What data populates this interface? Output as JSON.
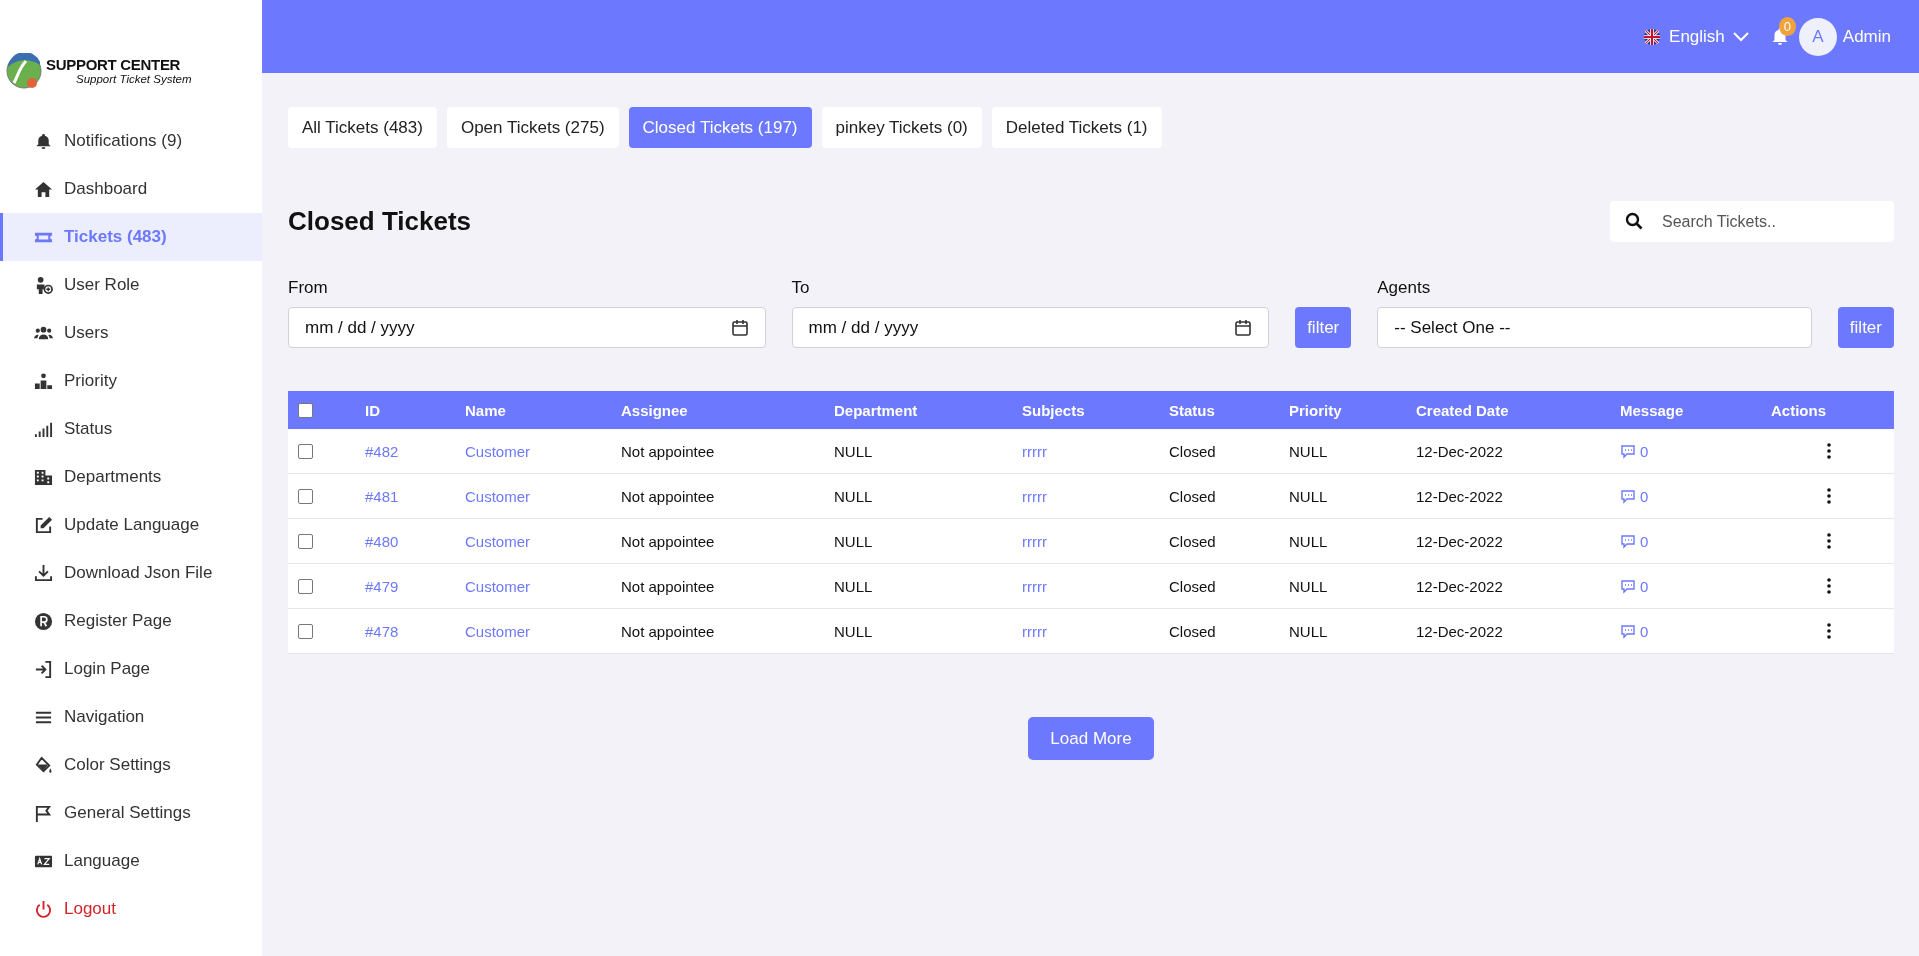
{
  "logo": {
    "title": "SUPPORT CENTER",
    "subtitle": "Support Ticket System"
  },
  "sidebar": {
    "items": [
      {
        "label": "Notifications (9)",
        "selected": false,
        "kind": "normal"
      },
      {
        "label": "Dashboard",
        "selected": false,
        "kind": "normal"
      },
      {
        "label": "Tickets (483)",
        "selected": true,
        "kind": "normal"
      },
      {
        "label": "User Role",
        "selected": false,
        "kind": "normal"
      },
      {
        "label": "Users",
        "selected": false,
        "kind": "normal"
      },
      {
        "label": "Priority",
        "selected": false,
        "kind": "normal"
      },
      {
        "label": "Status",
        "selected": false,
        "kind": "normal"
      },
      {
        "label": "Departments",
        "selected": false,
        "kind": "normal"
      },
      {
        "label": "Update Language",
        "selected": false,
        "kind": "normal"
      },
      {
        "label": "Download Json File",
        "selected": false,
        "kind": "normal"
      },
      {
        "label": "Register Page",
        "selected": false,
        "kind": "normal"
      },
      {
        "label": "Login Page",
        "selected": false,
        "kind": "normal"
      },
      {
        "label": "Navigation",
        "selected": false,
        "kind": "normal"
      },
      {
        "label": "Color Settings",
        "selected": false,
        "kind": "normal"
      },
      {
        "label": "General Settings",
        "selected": false,
        "kind": "normal"
      },
      {
        "label": "Language",
        "selected": false,
        "kind": "normal"
      },
      {
        "label": "Logout",
        "selected": false,
        "kind": "danger"
      }
    ]
  },
  "header": {
    "language": "English",
    "notification_count": "0",
    "avatar_letter": "A",
    "user": "Admin"
  },
  "tabs": [
    {
      "label": "All Tickets (483)",
      "selected": false
    },
    {
      "label": "Open Tickets (275)",
      "selected": false
    },
    {
      "label": "Closed Tickets (197)",
      "selected": true
    },
    {
      "label": "pinkey Tickets (0)",
      "selected": false
    },
    {
      "label": "Deleted Tickets (1)",
      "selected": false
    }
  ],
  "page_title": "Closed Tickets",
  "search": {
    "placeholder": "Search Tickets.."
  },
  "filters": {
    "from_label": "From",
    "from_value": "mm / dd / yyyy",
    "to_label": "To",
    "to_value": "mm / dd / yyyy",
    "date_filter_button": "filter",
    "agents_label": "Agents",
    "agents_value": "-- Select One --",
    "agents_filter_button": "filter"
  },
  "table": {
    "header_checked": false,
    "columns": [
      "ID",
      "Name",
      "Assignee",
      "Department",
      "Subjects",
      "Status",
      "Priority",
      "Created Date",
      "Message",
      "Actions"
    ],
    "rows": [
      {
        "checked": false,
        "id": "#482",
        "name": "Customer",
        "assignee": "Not appointee",
        "department": "NULL",
        "subject": "rrrrr",
        "status": "Closed",
        "priority": "NULL",
        "created": "12-Dec-2022",
        "messages": "0"
      },
      {
        "checked": false,
        "id": "#481",
        "name": "Customer",
        "assignee": "Not appointee",
        "department": "NULL",
        "subject": "rrrrr",
        "status": "Closed",
        "priority": "NULL",
        "created": "12-Dec-2022",
        "messages": "0"
      },
      {
        "checked": false,
        "id": "#480",
        "name": "Customer",
        "assignee": "Not appointee",
        "department": "NULL",
        "subject": "rrrrr",
        "status": "Closed",
        "priority": "NULL",
        "created": "12-Dec-2022",
        "messages": "0"
      },
      {
        "checked": false,
        "id": "#479",
        "name": "Customer",
        "assignee": "Not appointee",
        "department": "NULL",
        "subject": "rrrrr",
        "status": "Closed",
        "priority": "NULL",
        "created": "12-Dec-2022",
        "messages": "0"
      },
      {
        "checked": false,
        "id": "#478",
        "name": "Customer",
        "assignee": "Not appointee",
        "department": "NULL",
        "subject": "rrrrr",
        "status": "Closed",
        "priority": "NULL",
        "created": "12-Dec-2022",
        "messages": "0"
      }
    ]
  },
  "load_more": "Load More"
}
